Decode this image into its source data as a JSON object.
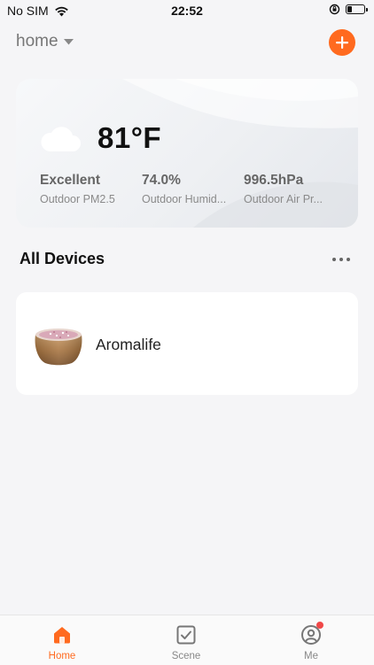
{
  "status_bar": {
    "carrier": "No SIM",
    "time": "22:52",
    "battery_level": 0.3
  },
  "header": {
    "home_label": "home",
    "icons": {
      "dropdown": "caret-down-icon",
      "add": "plus-icon"
    },
    "accent_color": "#ff6a1f"
  },
  "weather": {
    "icon": "cloud-icon",
    "temperature": "81°F",
    "metrics": [
      {
        "value": "Excellent",
        "label": "Outdoor PM2.5"
      },
      {
        "value": "74.0%",
        "label": "Outdoor Humid..."
      },
      {
        "value": "996.5hPa",
        "label": "Outdoor Air Pr..."
      }
    ]
  },
  "devices_section": {
    "title": "All Devices",
    "more_icon": "more-horizontal-icon"
  },
  "devices": [
    {
      "name": "Aromalife",
      "icon": "aroma-diffuser-image"
    }
  ],
  "tabbar": {
    "tabs": [
      {
        "label": "Home",
        "icon": "home-icon",
        "active": true
      },
      {
        "label": "Scene",
        "icon": "scene-checkbox-icon",
        "active": false
      },
      {
        "label": "Me",
        "icon": "profile-icon",
        "active": false,
        "badge": true
      }
    ]
  }
}
